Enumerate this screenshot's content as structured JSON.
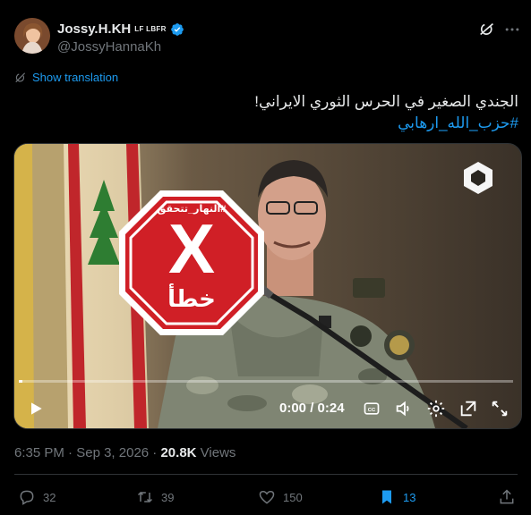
{
  "author": {
    "display_name": "Jossy.H.KH",
    "flags": "LF LBFR",
    "handle": "@JossyHannaKh"
  },
  "translate_label": "Show translation",
  "tweet": {
    "text": "الجندي الصغير في الحرس الثوري الايراني!",
    "hashtag": "#حزب_الله_ارهابي"
  },
  "video": {
    "stamp_hashtag": "#النهار_تتحقق",
    "stamp_mark": "X",
    "stamp_word": "خطأ",
    "time": "0:00 / 0:24",
    "progress": 0.0,
    "colors": {
      "stamp_red": "#d01f26"
    }
  },
  "meta": {
    "time": "6:35 PM",
    "date": "Sep 3, 2026",
    "views_count": "20.8K",
    "views_label": "Views"
  },
  "actions": {
    "replies": "32",
    "reposts": "39",
    "likes": "150",
    "bookmarks": "13"
  },
  "colors": {
    "accent": "#1d9bf0",
    "muted": "#71767b"
  }
}
